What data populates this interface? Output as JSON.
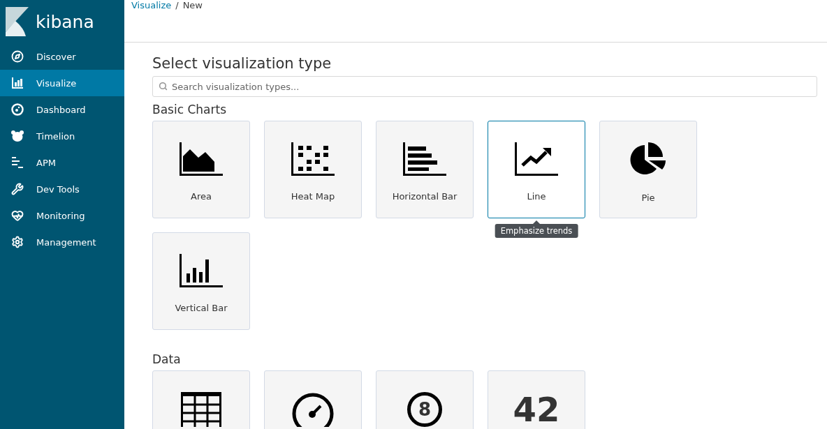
{
  "sidebar": {
    "logo": "kibana",
    "items": [
      {
        "label": "Discover",
        "kind": "compass",
        "selected": false
      },
      {
        "label": "Visualize",
        "kind": "chart",
        "selected": true
      },
      {
        "label": "Dashboard",
        "kind": "dashboard",
        "selected": false
      },
      {
        "label": "Timelion",
        "kind": "bear",
        "selected": false
      },
      {
        "label": "APM",
        "kind": "apm",
        "selected": false
      },
      {
        "label": "Dev Tools",
        "kind": "wrench",
        "selected": false
      },
      {
        "label": "Monitoring",
        "kind": "heart",
        "selected": false
      },
      {
        "label": "Management",
        "kind": "gear",
        "selected": false
      }
    ]
  },
  "breadcrumbs": [
    {
      "label": "Visualize",
      "kind": "link"
    },
    {
      "label": "/",
      "kind": "separator"
    },
    {
      "label": "New",
      "kind": "current"
    }
  ],
  "title": "Select visualization type",
  "search": {
    "placeholder": "Search visualization types..."
  },
  "sections": [
    {
      "heading": "Basic Charts",
      "cards": [
        {
          "label": "Area",
          "kind": "area",
          "selected": false
        },
        {
          "label": "Heat Map",
          "kind": "heatmap",
          "selected": false
        },
        {
          "label": "Horizontal Bar",
          "kind": "hbar",
          "selected": false
        },
        {
          "label": "Line",
          "kind": "line",
          "selected": true,
          "tooltip": "Emphasize trends"
        },
        {
          "label": "Pie",
          "kind": "pie",
          "selected": false
        },
        {
          "label": "Vertical Bar",
          "kind": "vbar",
          "selected": false
        }
      ]
    },
    {
      "heading": "Data",
      "cards": [
        {
          "kind": "table",
          "selected": false
        },
        {
          "kind": "gauge",
          "selected": false
        },
        {
          "kind": "goal",
          "icon_text": "8",
          "selected": false
        },
        {
          "kind": "metric",
          "icon_text": "42",
          "selected": false
        }
      ]
    }
  ]
}
